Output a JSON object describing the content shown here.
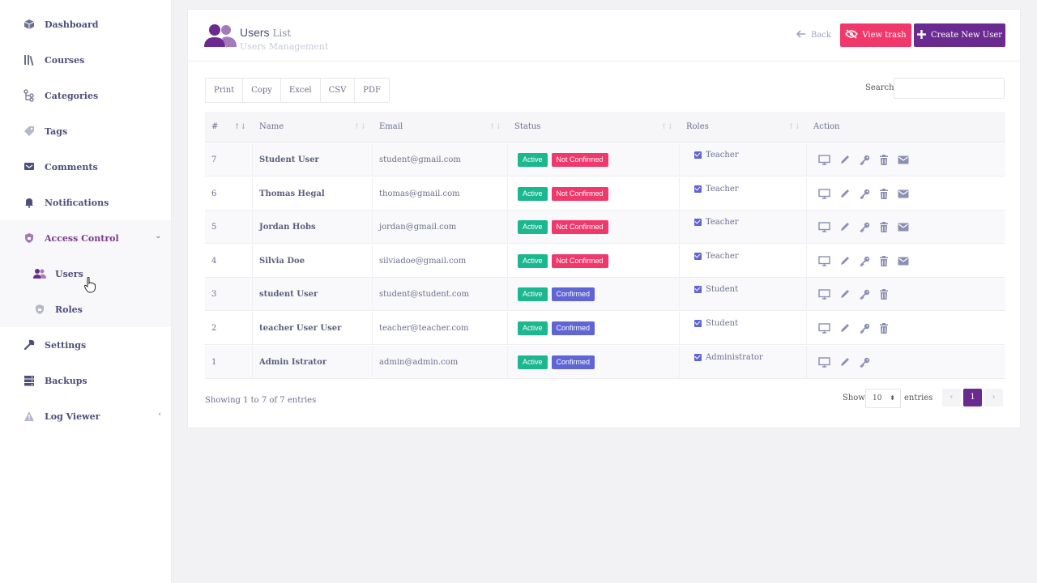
{
  "sidebar": {
    "items": [
      {
        "label": "Dashboard",
        "icon": "cube-icon"
      },
      {
        "label": "Courses",
        "icon": "books-icon"
      },
      {
        "label": "Categories",
        "icon": "sitemap-icon"
      },
      {
        "label": "Tags",
        "icon": "tag-icon"
      },
      {
        "label": "Comments",
        "icon": "comment-icon"
      },
      {
        "label": "Notifications",
        "icon": "bell-icon"
      },
      {
        "label": "Access Control",
        "icon": "shield-icon"
      },
      {
        "label": "Users",
        "icon": "users-icon"
      },
      {
        "label": "Roles",
        "icon": "lock-icon"
      },
      {
        "label": "Settings",
        "icon": "wrench-icon"
      },
      {
        "label": "Backups",
        "icon": "database-icon"
      },
      {
        "label": "Log Viewer",
        "icon": "warning-icon"
      }
    ]
  },
  "header": {
    "title": "Users",
    "title_small": "List",
    "subtitle": "Users Management",
    "back_label": "Back",
    "trash_label": "View trash",
    "create_label": "Create New User"
  },
  "toolbar": {
    "export_buttons": [
      "Print",
      "Copy",
      "Excel",
      "CSV",
      "PDF"
    ],
    "search_label": "Search:"
  },
  "table": {
    "columns": [
      "#",
      "Name",
      "Email",
      "Status",
      "Roles",
      "Action"
    ],
    "rows": [
      {
        "id": "7",
        "name": "Student User",
        "email": "student@gmail.com",
        "active": "Active",
        "confirm": "Not Confirmed",
        "role": "Teacher"
      },
      {
        "id": "6",
        "name": "Thomas Hegal",
        "email": "thomas@gmail.com",
        "active": "Active",
        "confirm": "Not Confirmed",
        "role": "Teacher"
      },
      {
        "id": "5",
        "name": "Jordan Hobs",
        "email": "jordan@gmail.com",
        "active": "Active",
        "confirm": "Not Confirmed",
        "role": "Teacher"
      },
      {
        "id": "4",
        "name": "Silvia Doe",
        "email": "silviadoe@gmail.com",
        "active": "Active",
        "confirm": "Not Confirmed",
        "role": "Teacher"
      },
      {
        "id": "3",
        "name": "student User",
        "email": "student@student.com",
        "active": "Active",
        "confirm": "Confirmed",
        "role": "Student"
      },
      {
        "id": "2",
        "name": "teacher User User",
        "email": "teacher@teacher.com",
        "active": "Active",
        "confirm": "Confirmed",
        "role": "Student"
      },
      {
        "id": "1",
        "name": "Admin Istrator",
        "email": "admin@admin.com",
        "active": "Active",
        "confirm": "Confirmed",
        "role": "Administrator"
      }
    ]
  },
  "footer": {
    "info": "Showing 1 to 7 of 7 entries",
    "show_label": "Show",
    "page_size": "10",
    "entries_label": "entries",
    "current_page": "1",
    "prev_glyph": "‹",
    "next_glyph": "›"
  },
  "colors": {
    "accent": "#6b2a8f",
    "danger": "#f0386b",
    "success": "#1bb78f",
    "info": "#5f65d4"
  }
}
